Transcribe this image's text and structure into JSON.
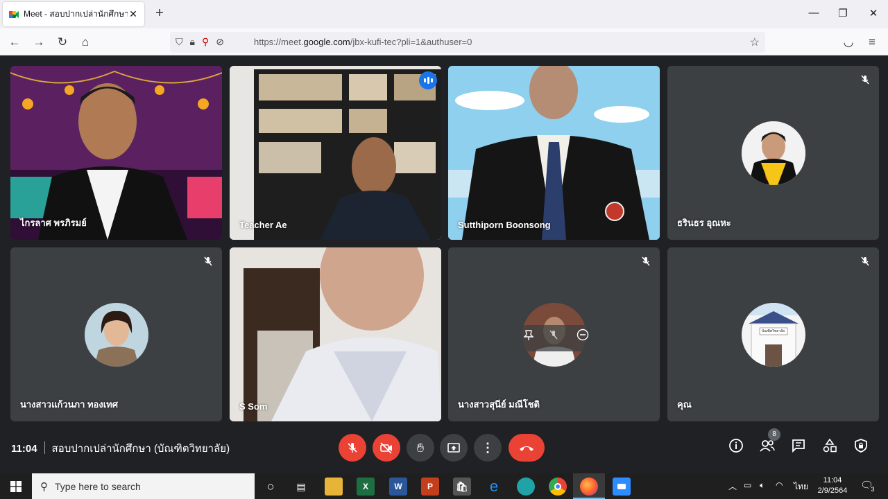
{
  "browser": {
    "tab_title": "Meet - สอบปากเปล่านักศึกษา (บัณ",
    "url_prefix": "https://meet.",
    "url_domain": "google.com",
    "url_rest": "/jbx-kufi-tec?pli=1&authuser=0"
  },
  "tiles": [
    {
      "name": "ไกรลาศ พรภิรมย์"
    },
    {
      "name": "Teacher Ae"
    },
    {
      "name": "Sutthiporn Boonsong"
    },
    {
      "name": "ธรินธร อุณหะ"
    },
    {
      "name": "นางสาวแก้วนภา ทองเทศ"
    },
    {
      "name": "S Som"
    },
    {
      "name": "นางสาวสุนีย์ มณีโชติ"
    },
    {
      "name": "คุณ"
    }
  ],
  "avatar_sign": "บัณฑิตวิทยาลัย",
  "meeting": {
    "time": "11:04",
    "title": "สอบปากเปล่านักศึกษา (บัณฑิตวิทยาลัย)",
    "participant_count": "8"
  },
  "taskbar": {
    "search_placeholder": "Type here to search",
    "language": "ไทย",
    "time": "11:04",
    "date": "2/9/2564",
    "notification_count": "3"
  },
  "colors": {
    "meet_bg": "#202124",
    "tile_bg": "#3c4043",
    "danger": "#ea4335",
    "accent": "#1a73e8"
  }
}
